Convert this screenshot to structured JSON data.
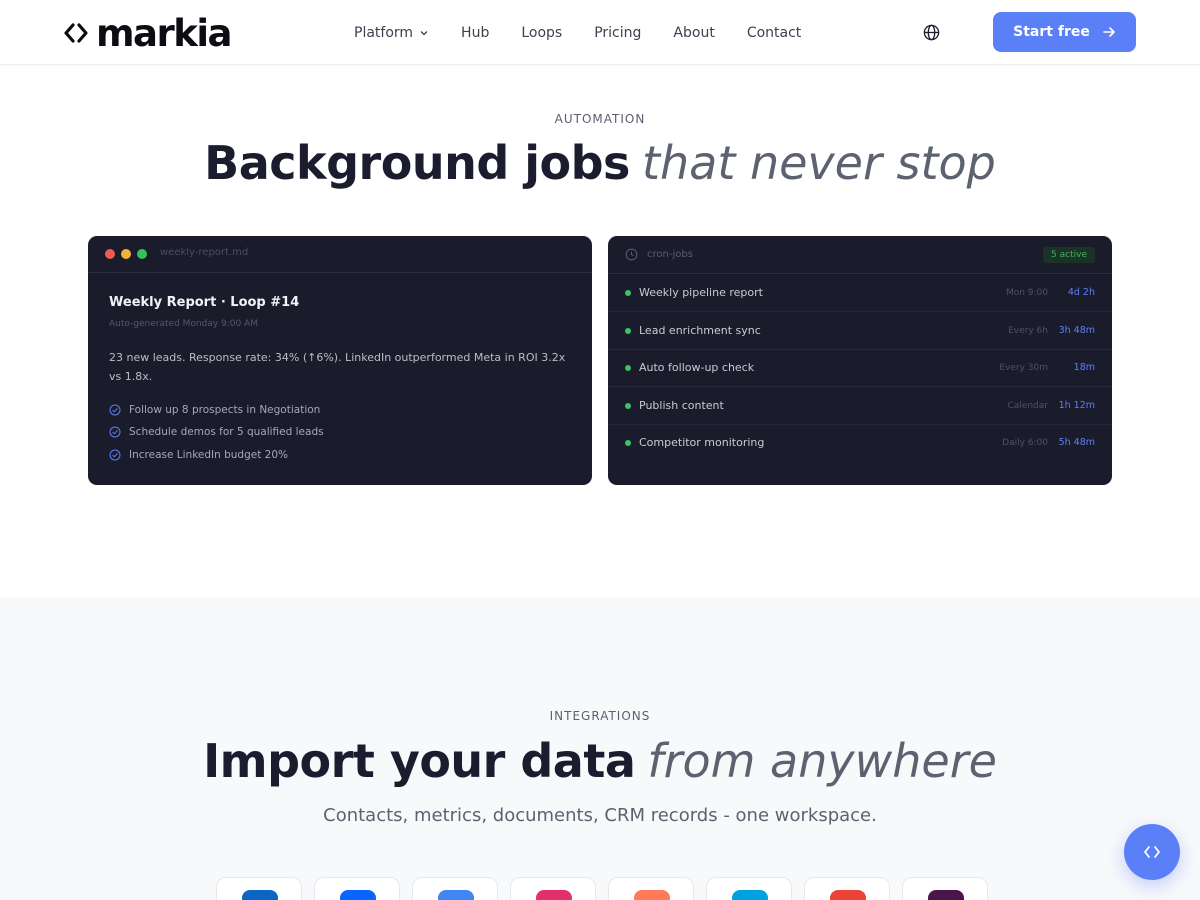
{
  "header": {
    "logo_text": "markia",
    "nav": [
      {
        "label": "Platform",
        "has_dropdown": true
      },
      {
        "label": "Hub"
      },
      {
        "label": "Loops"
      },
      {
        "label": "Pricing"
      },
      {
        "label": "About"
      },
      {
        "label": "Contact"
      }
    ],
    "cta_label": "Start free"
  },
  "automation": {
    "eyebrow": "AUTOMATION",
    "headline_strong": "Background jobs",
    "headline_soft": "that never stop",
    "report_card": {
      "file_name": "weekly-report.md",
      "title": "Weekly Report · Loop #14",
      "subtitle": "Auto-generated Monday 9:00 AM",
      "body": "23 new leads. Response rate: 34% (↑6%). LinkedIn outperformed Meta in ROI 3.2x vs 1.8x.",
      "todos": [
        "Follow up 8 prospects in Negotiation",
        "Schedule demos for 5 qualified leads",
        "Increase LinkedIn budget 20%"
      ]
    },
    "cron_card": {
      "title": "cron-jobs",
      "active_badge": "5 active",
      "jobs": [
        {
          "name": "Weekly pipeline report",
          "schedule": "Mon 9:00",
          "next": "4d 2h"
        },
        {
          "name": "Lead enrichment sync",
          "schedule": "Every 6h",
          "next": "3h 48m"
        },
        {
          "name": "Auto follow-up check",
          "schedule": "Every 30m",
          "next": "18m"
        },
        {
          "name": "Publish content",
          "schedule": "Calendar",
          "next": "1h 12m"
        },
        {
          "name": "Competitor monitoring",
          "schedule": "Daily 6:00",
          "next": "5h 48m"
        }
      ]
    }
  },
  "integrations": {
    "eyebrow": "INTEGRATIONS",
    "headline_strong": "Import your data",
    "headline_soft": "from anywhere",
    "subtitle": "Contacts, metrics, documents, CRM records - one workspace.",
    "tile_colors": [
      "#0a66c2",
      "#0866ff",
      "#4285f4",
      "#e1306c",
      "#ff7a59",
      "#00a1e0",
      "#ea4335",
      "#4a154b"
    ]
  },
  "colors": {
    "accent": "#5b7ff7",
    "status_green": "#3fc266",
    "card_bg": "#1b1c2b"
  }
}
